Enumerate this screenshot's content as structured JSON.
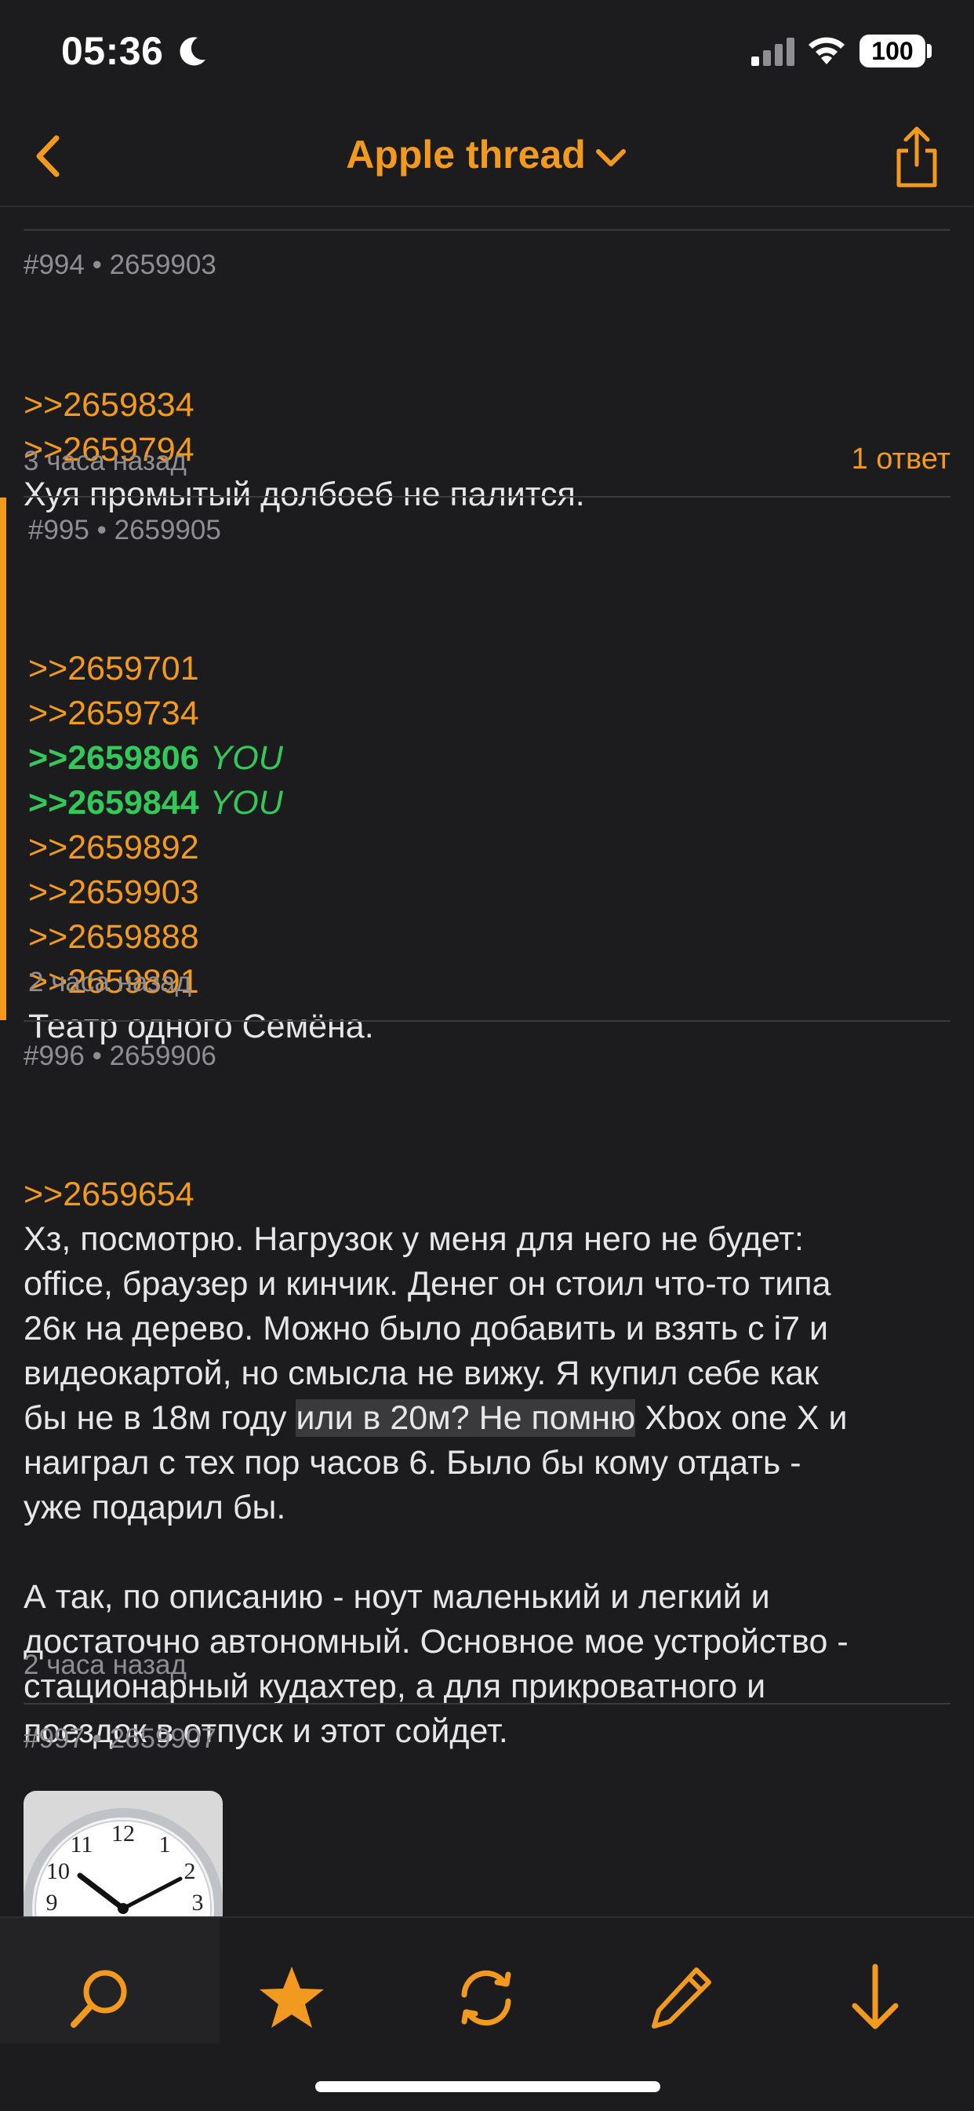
{
  "status_bar": {
    "time": "05:36",
    "battery": "100"
  },
  "nav": {
    "title": "Apple thread"
  },
  "posts": [
    {
      "header": "#994 • 2659903",
      "links": [
        ">>2659834",
        ">>2659794"
      ],
      "text": "Хуя промытый долбоеб не палится.",
      "time": "3 часа назад",
      "replies": "1 ответ"
    },
    {
      "header": "#995 • 2659905",
      "links": [
        ">>2659701",
        ">>2659734"
      ],
      "you_links": [
        ">>2659806",
        ">>2659844"
      ],
      "you_label": "YOU",
      "links2": [
        ">>2659892",
        ">>2659903",
        ">>2659888",
        ">>2659891"
      ],
      "text": "Театр одного Семёна.",
      "time": "2 часа назад"
    },
    {
      "header": "#996 • 2659906",
      "links": [
        ">>2659654"
      ],
      "text_part1": "Хз, посмотрю. Нагрузок у меня для него не будет:\noffice, браузер и кинчик. Денег он стоил что-то типа\n26к на дерево. Можно было добавить и взять с i7 и\nвидеокартой, но смысла не вижу. Я купил себе как\nбы не в 18м году ",
      "text_highlight": "или в 20м? Не помню",
      "text_part2": " Xbox one X и\nнаиграл с тех пор часов 6. Было бы кому отдать -\nуже подарил бы.\n\nА так, по описанию - ноут маленький и легкий и\nдостаточно автономный. Основное мое устройство -\nстационарный кудахтер, а для прикроватного и\nпоездок в отпуск и этот сойдет.",
      "time": "2 часа назад"
    },
    {
      "header": "#997 • 2659907"
    }
  ],
  "tab_bar": [
    "search-icon",
    "star-icon",
    "refresh-icon",
    "pencil-icon",
    "arrow-down-icon"
  ],
  "colors": {
    "accent": "#f29a1f",
    "you": "#34c759",
    "background": "#1c1c1e"
  }
}
